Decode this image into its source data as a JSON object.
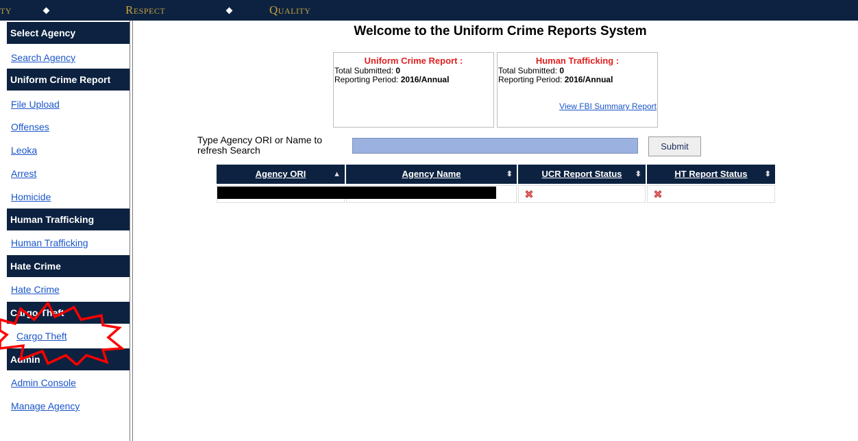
{
  "banner": {
    "motto_items": [
      "ty",
      "Respect",
      "Quality"
    ]
  },
  "sidebar": {
    "sections": [
      {
        "header": "Select Agency",
        "links": [
          "Search Agency"
        ]
      },
      {
        "header": "Uniform Crime Report",
        "links": [
          "File Upload",
          "Offenses",
          "Leoka",
          "Arrest",
          "Homicide"
        ]
      },
      {
        "header": "Human Trafficking",
        "links": [
          "Human Trafficking"
        ]
      },
      {
        "header": "Hate Crime",
        "links": [
          "Hate Crime"
        ]
      },
      {
        "header": "Cargo Theft",
        "links": [
          "Cargo Theft"
        ]
      },
      {
        "header": "Admin",
        "links": [
          "Admin Console",
          "Manage Agency"
        ]
      }
    ]
  },
  "main": {
    "title": "Welcome to the Uniform Crime Reports System",
    "cards": [
      {
        "title": "Uniform Crime Report :",
        "submitted_label": "Total Submitted:",
        "submitted_value": "0",
        "period_label": "Reporting Period:",
        "period_value": "2016/Annual",
        "link": ""
      },
      {
        "title": "Human Trafficking :",
        "submitted_label": "Total Submitted:",
        "submitted_value": "0",
        "period_label": "Reporting Period:",
        "period_value": "2016/Annual",
        "link": "View FBI Summary Report"
      }
    ],
    "search": {
      "label": "Type Agency ORI or Name to refresh Search",
      "value": "",
      "submit_label": "Submit"
    },
    "table": {
      "headers": [
        "Agency ORI",
        "Agency Name",
        "UCR Report Status",
        "HT Report Status"
      ],
      "rows": [
        {
          "ucr_status_icon": "red-x-icon",
          "ht_status_icon": "red-x-icon"
        }
      ]
    }
  },
  "colors": {
    "navy": "#0c2240",
    "gold": "#c8a23a",
    "link_blue": "#1a55c9",
    "card_title_red": "#e02020",
    "input_blue": "#9bb1e0",
    "annotation_red": "#ff0000"
  }
}
